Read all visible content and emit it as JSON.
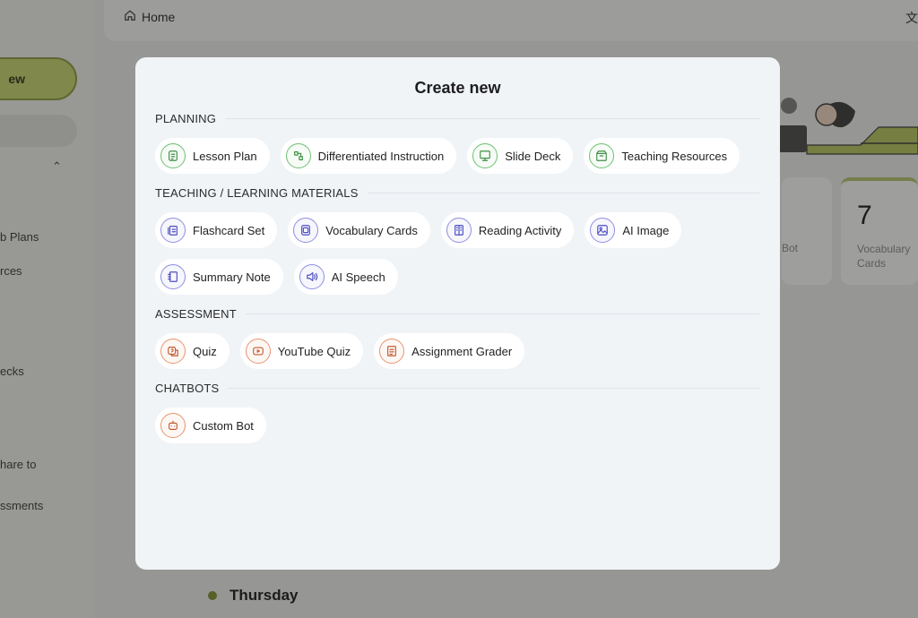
{
  "background": {
    "sidebar": {
      "new_label": "ew",
      "items": [
        {
          "label": "b Plans"
        },
        {
          "label": "rces"
        },
        {
          "label": "ecks"
        },
        {
          "label": "hare to"
        },
        {
          "label": "ssments"
        }
      ]
    },
    "topbar": {
      "home_label": "Home",
      "lang_glyph": "文"
    },
    "stats": {
      "bot_label": "Bot",
      "vocab_value": "7",
      "vocab_label": "Vocabulary Cards"
    },
    "day_label": "Thursday",
    "colors": {
      "accent": "#c9d86a"
    }
  },
  "modal": {
    "title": "Create new",
    "sections": [
      {
        "label": "PLANNING",
        "color": "green",
        "items": [
          {
            "label": "Lesson Plan",
            "icon": "lesson-plan-icon"
          },
          {
            "label": "Differentiated Instruction",
            "icon": "differentiate-icon"
          },
          {
            "label": "Slide Deck",
            "icon": "presentation-icon"
          },
          {
            "label": "Teaching Resources",
            "icon": "resources-box-icon"
          }
        ]
      },
      {
        "label": "TEACHING / LEARNING MATERIALS",
        "color": "purple",
        "items": [
          {
            "label": "Flashcard Set",
            "icon": "flashcard-icon"
          },
          {
            "label": "Vocabulary Cards",
            "icon": "vocabulary-cards-icon"
          },
          {
            "label": "Reading Activity",
            "icon": "book-icon"
          },
          {
            "label": "AI Image",
            "icon": "image-icon"
          },
          {
            "label": "Summary Note",
            "icon": "notebook-icon"
          },
          {
            "label": "AI Speech",
            "icon": "speaker-icon"
          }
        ]
      },
      {
        "label": "ASSESSMENT",
        "color": "orange",
        "items": [
          {
            "label": "Quiz",
            "icon": "quiz-icon"
          },
          {
            "label": "YouTube Quiz",
            "icon": "youtube-icon"
          },
          {
            "label": "Assignment Grader",
            "icon": "grader-icon"
          }
        ]
      },
      {
        "label": "CHATBOTS",
        "color": "orange",
        "items": [
          {
            "label": "Custom Bot",
            "icon": "bot-icon"
          }
        ]
      }
    ]
  }
}
